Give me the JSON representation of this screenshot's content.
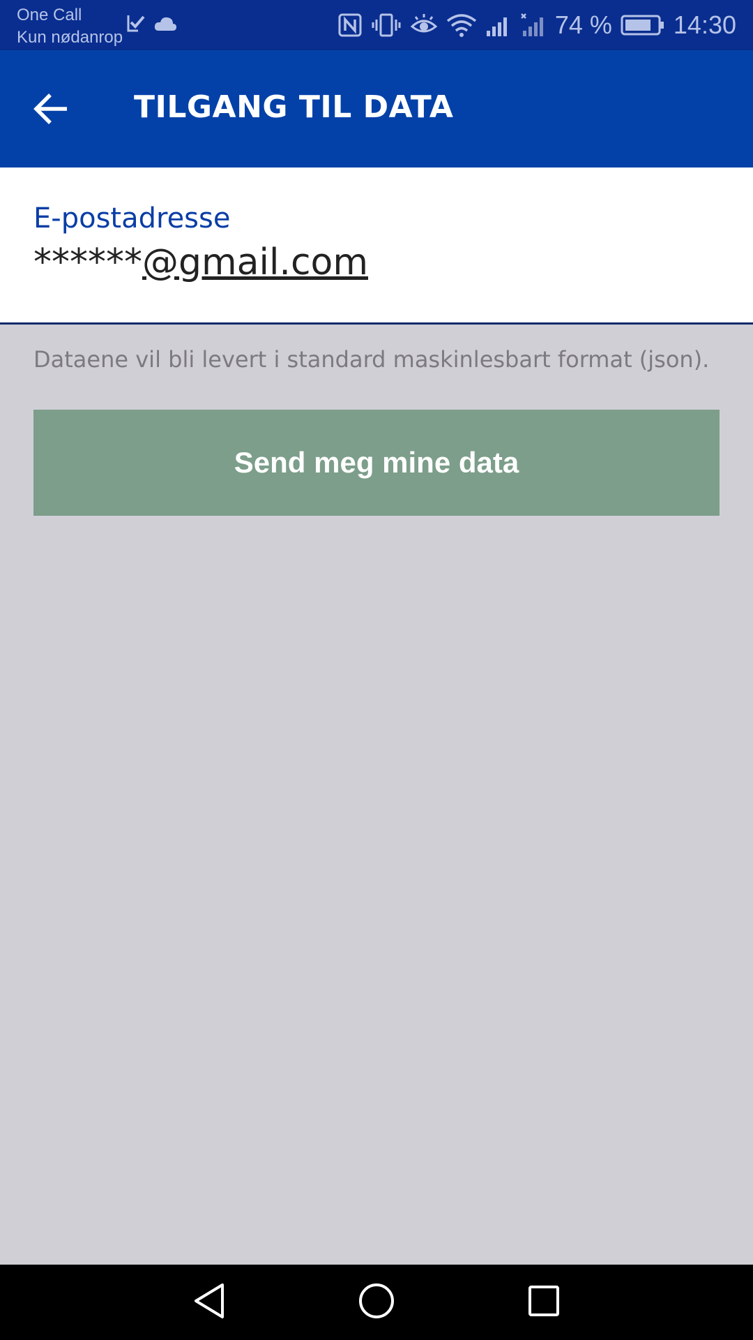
{
  "status_bar": {
    "carrier_line1": "One Call",
    "carrier_line2": "Kun nødanrop",
    "battery_percent": "74 %",
    "time": "14:30",
    "icons": [
      "checklist-icon",
      "cloud-icon",
      "nfc-icon",
      "vibrate-icon",
      "eye-comfort-icon",
      "wifi-icon",
      "signal-icon",
      "signal-no-service-icon",
      "battery-icon"
    ],
    "color": "#0a2e8f"
  },
  "app_bar": {
    "title": "TILGANG TIL DATA",
    "back_icon": "arrow-back-icon",
    "color": "#0341a8"
  },
  "email": {
    "label": "E-postadresse",
    "masked_local": "******",
    "domain": "@gmail.com"
  },
  "info": {
    "text": "Dataene vil bli levert i standard maskinlesbart format (json)."
  },
  "send_button": {
    "label": "Send meg mine data",
    "color": "#7c9e8a"
  },
  "nav_bar": {
    "items": [
      "back-triangle-icon",
      "home-circle-icon",
      "recents-square-icon"
    ]
  }
}
